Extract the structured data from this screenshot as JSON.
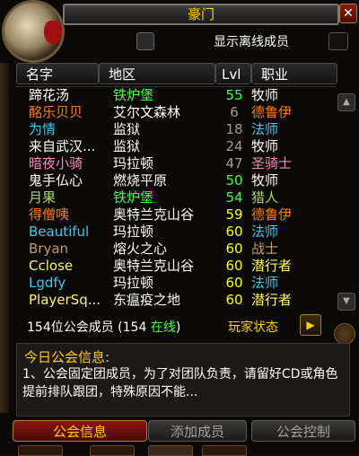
{
  "window": {
    "title": "豪门",
    "close": "✕"
  },
  "offline": {
    "label": "显示离线成员"
  },
  "columns": {
    "name": "名字",
    "zone": "地区",
    "level": "Lvl",
    "class": "职业"
  },
  "members": [
    {
      "name": "蹄花汤",
      "zone": "铁炉堡",
      "level": "55",
      "class": "牧师",
      "name_color": "#ffffff",
      "zone_color": "#40ff40",
      "level_color": "#40ff40",
      "class_color": "#ffffff"
    },
    {
      "name": "酩乐贝贝",
      "zone": "艾尔文森林",
      "level": "6",
      "class": "德鲁伊",
      "name_color": "#ff7d0a",
      "zone_color": "#ffffff",
      "level_color": "#9d9d9d",
      "class_color": "#ff7d0a"
    },
    {
      "name": "为情",
      "zone": "监狱",
      "level": "18",
      "class": "法师",
      "name_color": "#40c7eb",
      "zone_color": "#ffffff",
      "level_color": "#9d9d9d",
      "class_color": "#40c7eb"
    },
    {
      "name": "来自武汉...",
      "zone": "监狱",
      "level": "24",
      "class": "牧师",
      "name_color": "#ffffff",
      "zone_color": "#ffffff",
      "level_color": "#9d9d9d",
      "class_color": "#ffffff"
    },
    {
      "name": "暗夜小骑",
      "zone": "玛拉顿",
      "level": "47",
      "class": "圣骑士",
      "name_color": "#f58cba",
      "zone_color": "#ffffff",
      "level_color": "#9d9d9d",
      "class_color": "#f58cba"
    },
    {
      "name": "鬼手仏心",
      "zone": "燃烧平原",
      "level": "50",
      "class": "牧师",
      "name_color": "#ffffff",
      "zone_color": "#ffffff",
      "level_color": "#40ff40",
      "class_color": "#ffffff"
    },
    {
      "name": "月果",
      "zone": "铁炉堡",
      "level": "54",
      "class": "猎人",
      "name_color": "#abd473",
      "zone_color": "#40ff40",
      "level_color": "#40ff40",
      "class_color": "#abd473"
    },
    {
      "name": "得僧咦",
      "zone": "奥特兰克山谷",
      "level": "59",
      "class": "德鲁伊",
      "name_color": "#ff7d0a",
      "zone_color": "#ffffff",
      "level_color": "#ffff00",
      "class_color": "#ff7d0a"
    },
    {
      "name": "Beautiful",
      "zone": "玛拉顿",
      "level": "60",
      "class": "法师",
      "name_color": "#40c7eb",
      "zone_color": "#ffffff",
      "level_color": "#ffff00",
      "class_color": "#40c7eb"
    },
    {
      "name": "Bryan",
      "zone": "熔火之心",
      "level": "60",
      "class": "战士",
      "name_color": "#c79c6e",
      "zone_color": "#ffffff",
      "level_color": "#ffff00",
      "class_color": "#c79c6e"
    },
    {
      "name": "Cclose",
      "zone": "奥特兰克山谷",
      "level": "60",
      "class": "潜行者",
      "name_color": "#fff569",
      "zone_color": "#ffffff",
      "level_color": "#ffff00",
      "class_color": "#fff569"
    },
    {
      "name": "Lgdfy",
      "zone": "玛拉顿",
      "level": "60",
      "class": "法师",
      "name_color": "#40c7eb",
      "zone_color": "#ffffff",
      "level_color": "#ffff00",
      "class_color": "#40c7eb"
    },
    {
      "name": "PlayerSq...",
      "zone": "东瘟疫之地",
      "level": "60",
      "class": "潜行者",
      "name_color": "#fff569",
      "zone_color": "#ffffff",
      "level_color": "#ffff00",
      "class_color": "#fff569"
    }
  ],
  "summary": {
    "count_text": "154位公会成员 (154 ",
    "online_text": "在线",
    "close_paren": ")"
  },
  "player_status": {
    "label": "玩家状态",
    "arrow": "▶"
  },
  "motd": {
    "title": "今日公会信息:",
    "text": "1、公会固定团成员，为了对团队负责，请留好CD或角色提前排队跟团，特殊原因不能..."
  },
  "buttons": {
    "info": "公会信息",
    "add": "添加成员",
    "control": "公会控制"
  },
  "icons": {
    "emblem": "guild-scroll-icon",
    "scroll_up": "▲",
    "scroll_down": "▼"
  },
  "colors": {
    "gold": "#ffd100",
    "online_green": "#40ff40"
  }
}
